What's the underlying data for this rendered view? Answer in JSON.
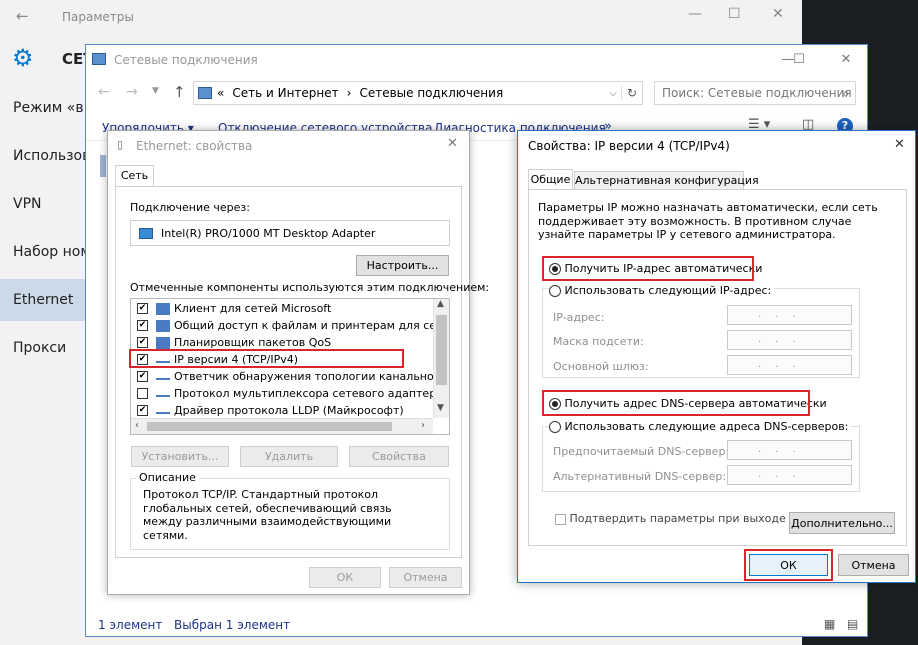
{
  "settings": {
    "title": "Параметры",
    "header_partial": "СЕТ",
    "nav": [
      "Режим «в",
      "Использов",
      "VPN",
      "Набор ном",
      "Ethernet",
      "Прокси"
    ]
  },
  "netconn": {
    "title": "Сетевые подключения",
    "breadcrumb": {
      "prefix": "«",
      "parent": "Сеть и Интернет",
      "sep": "›",
      "current": "Сетевые подключения"
    },
    "search_placeholder": "Поиск: Сетевые подключения",
    "toolbar": [
      "Упорядочить ▾",
      "Отключение сетевого устройства",
      "Диагностика подключения",
      "»"
    ],
    "status": {
      "count": "1 элемент",
      "selected": "Выбран 1 элемент"
    }
  },
  "eth": {
    "title": "Ethernet: свойства",
    "tab": "Сеть",
    "connect_via_label": "Подключение через:",
    "adapter": "Intel(R) PRO/1000 MT Desktop Adapter",
    "configure_btn": "Настроить...",
    "components_label": "Отмеченные компоненты используются этим подключением:",
    "components": [
      {
        "label": "Клиент для сетей Microsoft",
        "checked": true
      },
      {
        "label": "Общий доступ к файлам и принтерам для сетей Mi",
        "checked": true
      },
      {
        "label": "Планировщик пакетов QoS",
        "checked": true
      },
      {
        "label": "IP версии 4 (TCP/IPv4)",
        "checked": true
      },
      {
        "label": "Ответчик обнаружения топологии канального уров",
        "checked": true
      },
      {
        "label": "Протокол мультиплексора сетевого адаптера (Май",
        "checked": false
      },
      {
        "label": "Драйвер протокола LLDP (Майкрософт)",
        "checked": true
      }
    ],
    "install_btn": "Установить...",
    "remove_btn": "Удалить",
    "props_btn": "Свойства",
    "desc_title": "Описание",
    "desc_text": "Протокол TCP/IP. Стандартный протокол глобальных сетей, обеспечивающий связь между различными взаимодействующими сетями.",
    "ok": "ОК",
    "cancel": "Отмена"
  },
  "ipv4": {
    "title": "Свойства: IP версии 4 (TCP/IPv4)",
    "tabs": [
      "Общие",
      "Альтернативная конфигурация"
    ],
    "intro": "Параметры IP можно назначать автоматически, если сеть поддерживает эту возможность. В противном случае узнайте параметры IP у сетевого администратора.",
    "ip_auto": "Получить IP-адрес автоматически",
    "ip_manual": "Использовать следующий IP-адрес:",
    "ip_label": "IP-адрес:",
    "mask_label": "Маска подсети:",
    "gw_label": "Основной шлюз:",
    "dns_auto": "Получить адрес DNS-сервера автоматически",
    "dns_manual": "Использовать следующие адреса DNS-серверов:",
    "dns_pref": "Предпочитаемый DNS-сервер:",
    "dns_alt": "Альтернативный DNS-сервер:",
    "validate": "Подтвердить параметры при выходе",
    "advanced": "Дополнительно...",
    "ok": "ОК",
    "cancel": "Отмена",
    "ip_dots": "...",
    "accent": "#0078d7",
    "highlight": "#d9262c"
  }
}
